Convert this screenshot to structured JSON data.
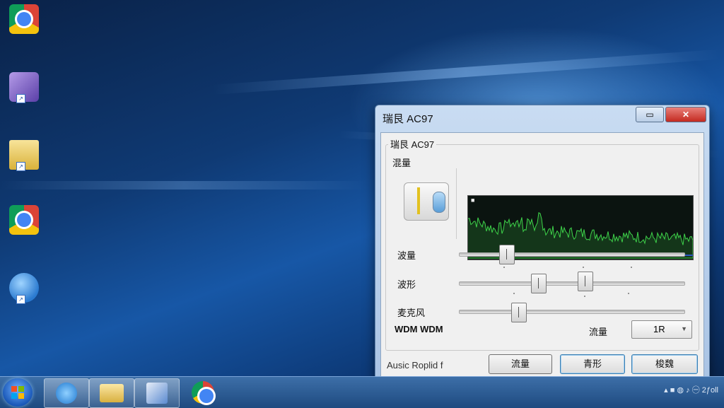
{
  "desktop": {
    "icons": [
      {
        "icon": "chrome-icon",
        "label": ""
      },
      {
        "icon": "app-box-icon",
        "label": ""
      },
      {
        "icon": "folder-icon",
        "label": ""
      },
      {
        "icon": "chrome-icon",
        "label": ""
      },
      {
        "icon": "globe-icon",
        "label": ""
      }
    ]
  },
  "dialog": {
    "title": "瑞艮 AC97",
    "group_title": "瑞艮 AC97",
    "section_label": "混量",
    "scope_corner": "■",
    "sliders": [
      {
        "label": "波量",
        "value": 0.22
      },
      {
        "label": "波形",
        "value": 0.35,
        "value2": 0.55
      },
      {
        "label": "麦克风",
        "value": 0.27
      }
    ],
    "device_label": "WDM WDM",
    "stream_label": "流量",
    "combo_value": "1R",
    "footer_label": "Ausic Roplid f",
    "buttons": {
      "b1": "流量",
      "b2": "青形",
      "b3": "梭魏"
    },
    "minimize_symbol": "▭",
    "close_symbol": "✕"
  },
  "tray": {
    "text": "㊀ 2ƒoll"
  },
  "colors": {
    "wave": "#3ed34a",
    "scope_bg": "#0b1410",
    "accent": "#3c7fb1"
  }
}
